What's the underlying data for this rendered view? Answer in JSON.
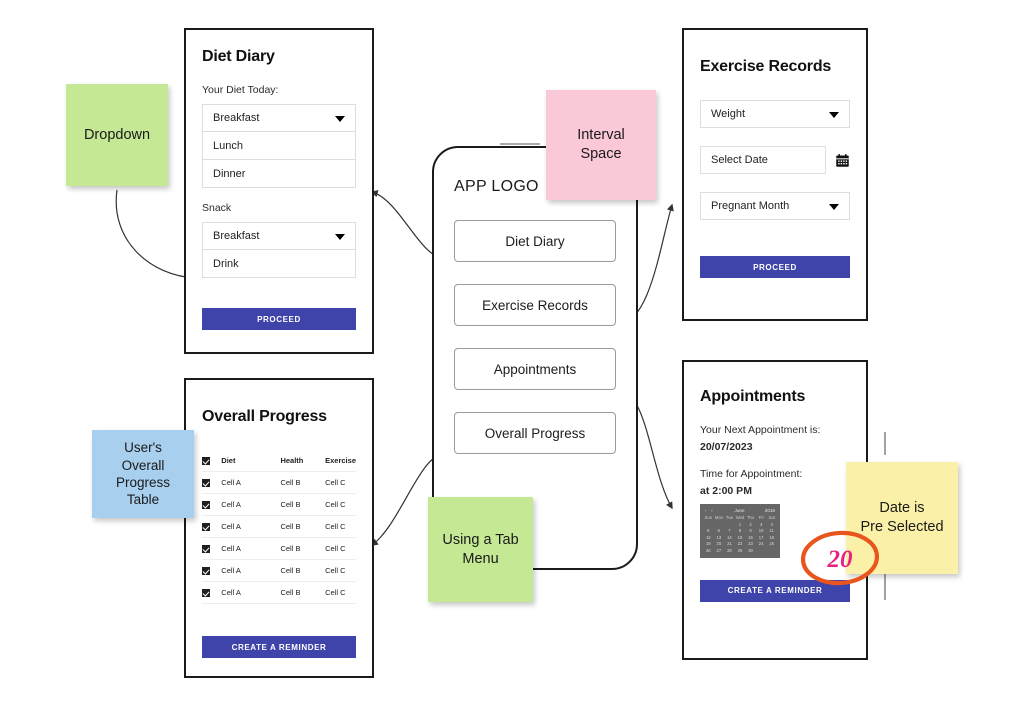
{
  "tab_menu": {
    "logo": "APP LOGO",
    "items": [
      {
        "label": "Diet Diary"
      },
      {
        "label": "Exercise Records"
      },
      {
        "label": "Appointments"
      },
      {
        "label": "Overall Progress"
      }
    ]
  },
  "diet_diary": {
    "title": "Diet Diary",
    "section_label": "Your Diet Today:",
    "meal_dropdown": "Breakfast",
    "lunch": "Lunch",
    "dinner": "Dinner",
    "snack_label": "Snack",
    "snack_dropdown": "Breakfast",
    "drink": "Drink",
    "proceed_label": "PROCEED"
  },
  "exercise_records": {
    "title": "Exercise Records",
    "metric_dropdown": "Weight",
    "date_placeholder": "Select Date",
    "month_dropdown": "Pregnant Month",
    "proceed_label": "PROCEED",
    "calendar_icon": "calendar-icon"
  },
  "overall_progress": {
    "title": "Overall Progress",
    "columns": [
      "Diet",
      "Health",
      "Exercise"
    ],
    "rows": [
      [
        "Cell A",
        "Cell B",
        "Cell C"
      ],
      [
        "Cell A",
        "Cell B",
        "Cell C"
      ],
      [
        "Cell A",
        "Cell B",
        "Cell C"
      ],
      [
        "Cell A",
        "Cell B",
        "Cell C"
      ],
      [
        "Cell A",
        "Cell B",
        "Cell C"
      ],
      [
        "Cell A",
        "Cell B",
        "Cell C"
      ]
    ],
    "reminder_label": "CREATE A REMINDER"
  },
  "appointments": {
    "title": "Appointments",
    "next_label": "Your Next Appointment is:",
    "next_date": "20/07/2023",
    "time_label": "Time for Appointment:",
    "time_value": "at 2:00 PM",
    "reminder_label": "CREATE A REMINDER",
    "calendar": {
      "prev": "‹",
      "next": "›",
      "month": "June",
      "year": "2016",
      "day_headers": [
        "Sun",
        "Mon",
        "Tue",
        "Wed",
        "Thu",
        "Fri",
        "Sat"
      ],
      "leading_blanks": 3,
      "days": [
        1,
        2,
        3,
        4,
        5,
        6,
        7,
        8,
        9,
        10,
        11,
        12,
        13,
        14,
        15,
        16,
        17,
        18,
        19,
        20,
        21,
        22,
        23,
        24,
        25,
        26,
        27,
        28,
        29,
        30
      ]
    }
  },
  "notes": [
    {
      "id": "note-dropdown",
      "text": "Dropdown",
      "color": "#c5e894"
    },
    {
      "id": "note-interval-space",
      "text": "Interval\nSpace",
      "color": "#fbc8d8"
    },
    {
      "id": "note-progress-table",
      "text": "User's\nOverall\nProgress\nTable",
      "color": "#a8cfee"
    },
    {
      "id": "note-tab-menu",
      "text": "Using a Tab\nMenu",
      "color": "#c5e894"
    },
    {
      "id": "note-date-preselected",
      "text": "Date is\nPre Selected",
      "color": "#fbf0a8"
    }
  ],
  "annotation": {
    "mark_text": "20",
    "mark_color": "#e8237f",
    "circle_color": "#e8561e"
  },
  "theme": {
    "primary": "#3f44ab",
    "panel_border": "#1a1a1a",
    "field_border": "#dddddd",
    "calendar_bg": "#666666"
  }
}
